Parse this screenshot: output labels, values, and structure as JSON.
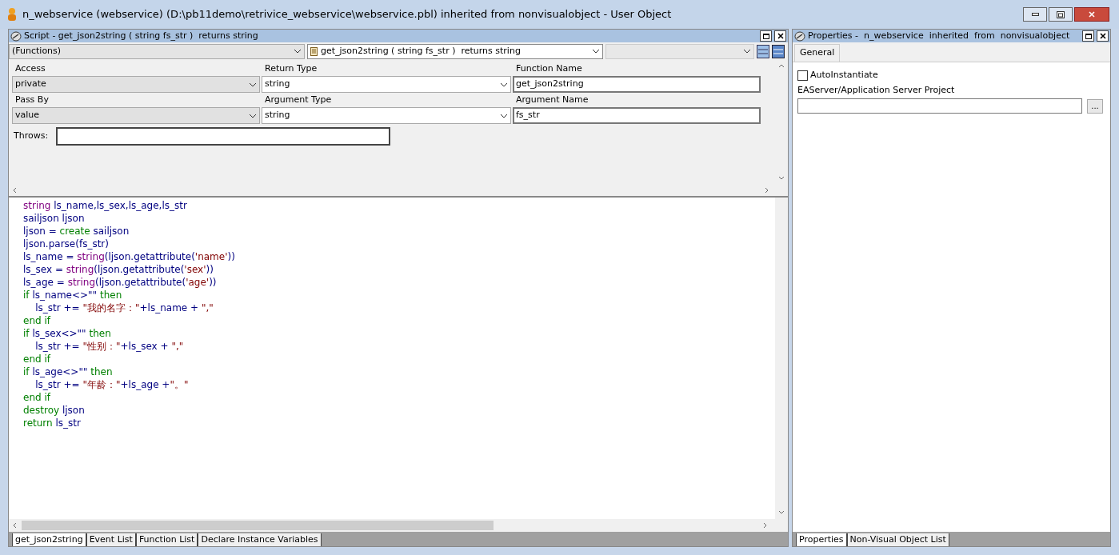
{
  "window": {
    "title": "n_webservice (webservice) (D:\\pb11demo\\retrivice_webservice\\webservice.pbl) inherited from nonvisualobject - User Object"
  },
  "script_pane": {
    "title": "Script - get_json2string ( string fs_str )  returns string",
    "object_dropdown": "(Functions)",
    "function_dropdown": "get_json2string ( string fs_str )  returns string",
    "fields": [
      {
        "label": "Access",
        "value": "private",
        "kind": "combo"
      },
      {
        "label": "Return Type",
        "value": "string",
        "kind": "dropdown"
      },
      {
        "label": "Function Name",
        "value": "get_json2string",
        "kind": "text"
      },
      {
        "label": "Pass By",
        "value": "value",
        "kind": "combo"
      },
      {
        "label": "Argument Type",
        "value": "string",
        "kind": "dropdown"
      },
      {
        "label": "Argument Name",
        "value": "fs_str",
        "kind": "text"
      }
    ],
    "throws_label": "Throws:",
    "code": [
      [
        {
          "text": "string",
          "kind": "type"
        },
        {
          "text": " ls_name,ls_sex,ls_age,ls_str",
          "kind": "plain"
        }
      ],
      [
        {
          "text": "sailjson ljson",
          "kind": "plain"
        }
      ],
      [
        {
          "text": "ljson = ",
          "kind": "plain"
        },
        {
          "text": "create",
          "kind": "keyword"
        },
        {
          "text": " sailjson",
          "kind": "plain"
        }
      ],
      [
        {
          "text": "ljson.parse(fs_str)",
          "kind": "plain"
        }
      ],
      [
        {
          "text": "ls_name = ",
          "kind": "plain"
        },
        {
          "text": "string",
          "kind": "type"
        },
        {
          "text": "(ljson.getattribute(",
          "kind": "plain"
        },
        {
          "text": "'name'",
          "kind": "literal"
        },
        {
          "text": "))",
          "kind": "plain"
        }
      ],
      [
        {
          "text": "ls_sex = ",
          "kind": "plain"
        },
        {
          "text": "string",
          "kind": "type"
        },
        {
          "text": "(ljson.getattribute(",
          "kind": "plain"
        },
        {
          "text": "'sex'",
          "kind": "literal"
        },
        {
          "text": "))",
          "kind": "plain"
        }
      ],
      [
        {
          "text": "ls_age = ",
          "kind": "plain"
        },
        {
          "text": "string",
          "kind": "type"
        },
        {
          "text": "(ljson.getattribute(",
          "kind": "plain"
        },
        {
          "text": "'age'",
          "kind": "literal"
        },
        {
          "text": "))",
          "kind": "plain"
        }
      ],
      [
        {
          "text": "if",
          "kind": "keyword"
        },
        {
          "text": " ls_name<>\"\" ",
          "kind": "plain"
        },
        {
          "text": "then",
          "kind": "keyword"
        }
      ],
      [
        {
          "text": "    ls_str += ",
          "kind": "plain"
        },
        {
          "text": "\"我的名字：\"",
          "kind": "literal"
        },
        {
          "text": "+ls_name + ",
          "kind": "plain"
        },
        {
          "text": "\",\"",
          "kind": "literal"
        }
      ],
      [
        {
          "text": "end if",
          "kind": "keyword"
        }
      ],
      [
        {
          "text": "if",
          "kind": "keyword"
        },
        {
          "text": " ls_sex<>\"\" ",
          "kind": "plain"
        },
        {
          "text": "then",
          "kind": "keyword"
        }
      ],
      [
        {
          "text": "    ls_str += ",
          "kind": "plain"
        },
        {
          "text": "\"性别：\"",
          "kind": "literal"
        },
        {
          "text": "+ls_sex + ",
          "kind": "plain"
        },
        {
          "text": "\",\"",
          "kind": "literal"
        }
      ],
      [
        {
          "text": "end if",
          "kind": "keyword"
        }
      ],
      [
        {
          "text": "if",
          "kind": "keyword"
        },
        {
          "text": " ls_age<>\"\" ",
          "kind": "plain"
        },
        {
          "text": "then",
          "kind": "keyword"
        }
      ],
      [
        {
          "text": "    ls_str += ",
          "kind": "plain"
        },
        {
          "text": "\"年龄：\"",
          "kind": "literal"
        },
        {
          "text": "+ls_age +",
          "kind": "plain"
        },
        {
          "text": "\"。\"",
          "kind": "literal"
        }
      ],
      [
        {
          "text": "end if",
          "kind": "keyword"
        }
      ],
      [
        {
          "text": "destroy",
          "kind": "keyword"
        },
        {
          "text": " ljson",
          "kind": "plain"
        }
      ],
      [
        {
          "text": "return",
          "kind": "keyword"
        },
        {
          "text": " ls_str",
          "kind": "plain"
        }
      ]
    ],
    "tabs": [
      {
        "label": "get_json2string",
        "selected": true
      },
      {
        "label": "Event List",
        "selected": false
      },
      {
        "label": "Function List",
        "selected": false
      },
      {
        "label": "Declare Instance Variables",
        "selected": false
      }
    ]
  },
  "properties_pane": {
    "title": "Properties -  n_webservice  inherited  from  nonvisualobject",
    "tab": "General",
    "auto_instantiate": {
      "label": "AutoInstantiate",
      "checked": false
    },
    "project_label": "EAServer/Application Server Project",
    "browse_button": "...",
    "tabs": [
      {
        "label": "Properties",
        "selected": true
      },
      {
        "label": "Non-Visual Object List",
        "selected": false
      }
    ]
  }
}
